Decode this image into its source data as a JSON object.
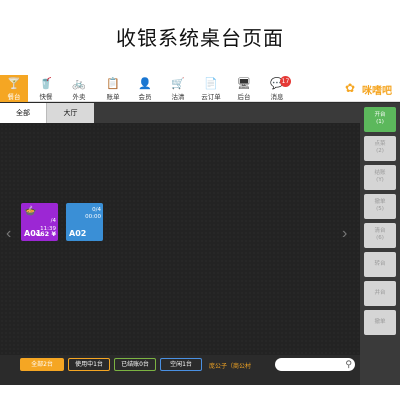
{
  "page_heading": "收银系统桌台页面",
  "nav": {
    "items": [
      {
        "label": "餐台",
        "icon": "🍸"
      },
      {
        "label": "快餐",
        "icon": "🥤"
      },
      {
        "label": "外卖",
        "icon": "🚲"
      },
      {
        "label": "账单",
        "icon": "📋"
      },
      {
        "label": "会员",
        "icon": "👤"
      },
      {
        "label": "沽清",
        "icon": "🛒"
      },
      {
        "label": "云订单",
        "icon": "📄"
      },
      {
        "label": "后台",
        "icon": "🖥"
      },
      {
        "label": "消息",
        "icon": "💬"
      }
    ],
    "message_badge": "17",
    "logo_text": "咪嗜吧"
  },
  "tabs": [
    "全部",
    "大厅"
  ],
  "tables": [
    {
      "name": "A01",
      "guests": "/4",
      "time": "11:39",
      "amount": "462 ¥",
      "status": "occupied"
    },
    {
      "name": "A02",
      "guests": "0/4",
      "time": "00:00",
      "amount": "",
      "status": "free"
    }
  ],
  "sidebar": {
    "buttons": [
      {
        "label": "开台",
        "shortcut": "(1)"
      },
      {
        "label": "点菜",
        "shortcut": "(2)"
      },
      {
        "label": "结账",
        "shortcut": "(Y)"
      },
      {
        "label": "撤单",
        "shortcut": "(5)"
      },
      {
        "label": "清台",
        "shortcut": "(6)"
      },
      {
        "label": "转台",
        "shortcut": ""
      },
      {
        "label": "并台",
        "shortcut": ""
      },
      {
        "label": "撤单",
        "shortcut": ""
      }
    ]
  },
  "bottom": {
    "filter_all": "全部2台",
    "filter_using": "使用中1台",
    "filter_settled": "已结账0台",
    "filter_idle": "空闲1台",
    "staff": "庞公子（商公村"
  },
  "colors": {
    "accent": "#f5a623",
    "occupied": "#9c27d4",
    "free": "#3a8fd6",
    "primary_action": "#5cb85c"
  }
}
